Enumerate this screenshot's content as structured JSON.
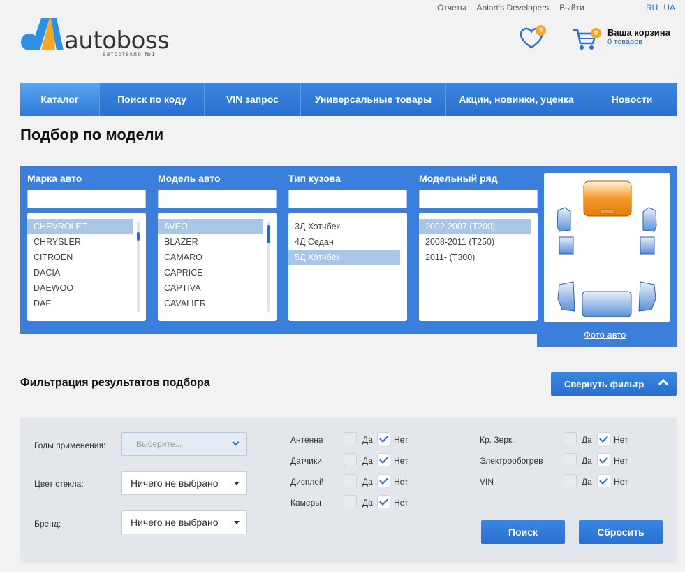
{
  "top_links": [
    "Отчеты",
    "Aniart's Developers",
    "Выйти"
  ],
  "languages": [
    "RU",
    "UA"
  ],
  "logo": {
    "text": "autoboss",
    "tagline": "автостекло №1"
  },
  "wishlist": {
    "count": "0"
  },
  "cart": {
    "count": "0",
    "title": "Ваша корзина",
    "items_label": "0 товаров"
  },
  "nav": {
    "items": [
      {
        "label": "Каталог",
        "active": true
      },
      {
        "label": "Поиск по коду"
      },
      {
        "label": "VIN запрос"
      },
      {
        "label": "Универсальные товары"
      },
      {
        "label": "Акции, новинки, уценка"
      },
      {
        "label": "Новости"
      }
    ]
  },
  "page_title": "Подбор по модели",
  "selector": {
    "make": {
      "label": "Марка авто",
      "items": [
        "CHEVROLET",
        "CHRYSLER",
        "CITROEN",
        "DACIA",
        "DAEWOO",
        "DAF"
      ],
      "selected": "CHEVROLET"
    },
    "model": {
      "label": "Модель авто",
      "items": [
        "AVEO",
        "BLAZER",
        "CAMARO",
        "CAPRICE",
        "CAPTIVA",
        "CAVALIER"
      ],
      "selected": "AVEO"
    },
    "body": {
      "label": "Тип кузова",
      "items": [
        "3Д Хэтчбек",
        "4Д Седан",
        "5Д Хэтчбек"
      ],
      "selected": "5Д Хэтчбек"
    },
    "series": {
      "label": "Модельный ряд",
      "items": [
        "2002-2007 (T200)",
        "2008-2011 (T250)",
        "2011- (T300)"
      ],
      "selected": "2002-2007 (T200)"
    },
    "photo_link": "Фото авто"
  },
  "filter": {
    "title": "Фильтрация результатов подбора",
    "collapse_label": "Свернуть фильтр",
    "years": {
      "label": "Годы применения:",
      "placeholder": "Выберите..."
    },
    "glass_color": {
      "label": "Цвет стекла:",
      "value": "Ничего не выбрано"
    },
    "brand": {
      "label": "Бренд:",
      "value": "Ничего не выбрано"
    },
    "yes_label": "Да",
    "no_label": "Нет",
    "options_left": [
      {
        "label": "Антенна",
        "yes": false,
        "no": true
      },
      {
        "label": "Датчики",
        "yes": false,
        "no": true
      },
      {
        "label": "Дисплей",
        "yes": false,
        "no": true
      },
      {
        "label": "Камеры",
        "yes": false,
        "no": true
      }
    ],
    "options_right": [
      {
        "label": "Кр. Зерк.",
        "yes": false,
        "no": true
      },
      {
        "label": "Электрообогрев",
        "yes": false,
        "no": true
      },
      {
        "label": "VIN",
        "yes": false,
        "no": true
      }
    ],
    "search_button": "Поиск",
    "reset_button": "Сбросить"
  },
  "colors": {
    "accent": "#2a70cf",
    "badge": "#f5a623",
    "selected_item": "#a9c5e8"
  }
}
